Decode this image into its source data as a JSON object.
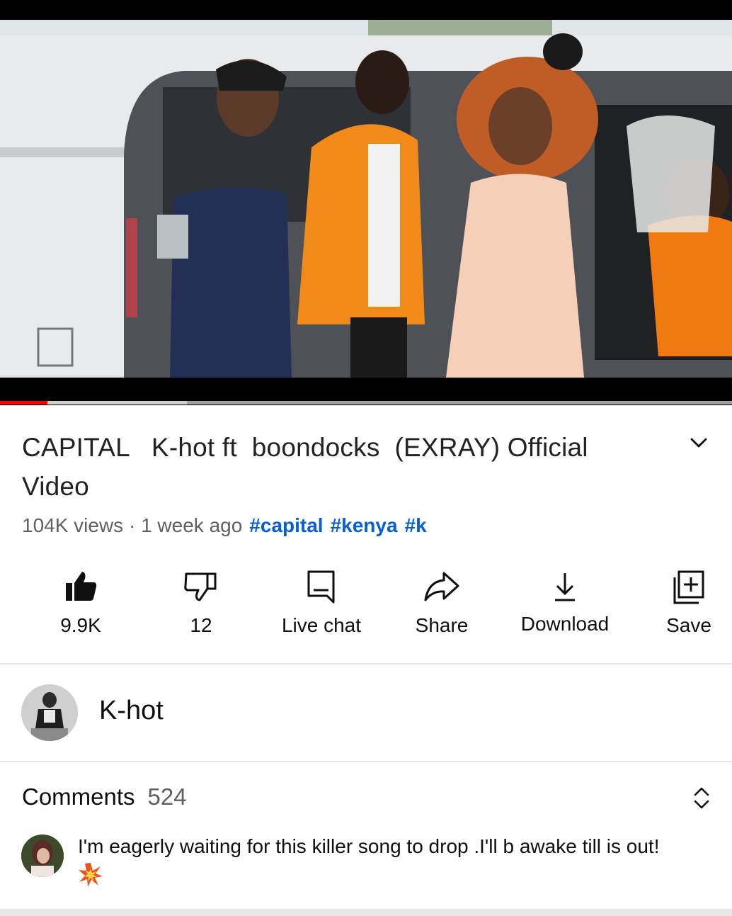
{
  "video": {
    "progress_played_fraction": 0.065,
    "progress_buffered_fraction": 0.255
  },
  "title": "CAPITAL   K-hot ft  boondocks  (EXRAY) Official Video",
  "meta": {
    "views": "104K views",
    "separator": " · ",
    "age": "1 week ago",
    "hashtags": [
      "#capital",
      "#kenya",
      "#k"
    ]
  },
  "actions": {
    "like": "9.9K",
    "dislike": "12",
    "live_chat": "Live chat",
    "share": "Share",
    "download": "Download",
    "save": "Save"
  },
  "channel": {
    "name": "K-hot"
  },
  "comments": {
    "label": "Comments",
    "count": "524",
    "top_comment": "I'm eagerly waiting for this killer song to drop .I'll b awake till is out!"
  },
  "colors": {
    "accent_red": "#ff0000",
    "hashtag_blue": "#065fd4",
    "secondary_text": "#606060"
  },
  "icons": [
    "thumbs-up-filled-icon",
    "thumbs-down-icon",
    "live-chat-icon",
    "share-icon",
    "download-icon",
    "save-playlist-icon",
    "chevron-down-icon",
    "sort-icon",
    "collision-emoji"
  ]
}
